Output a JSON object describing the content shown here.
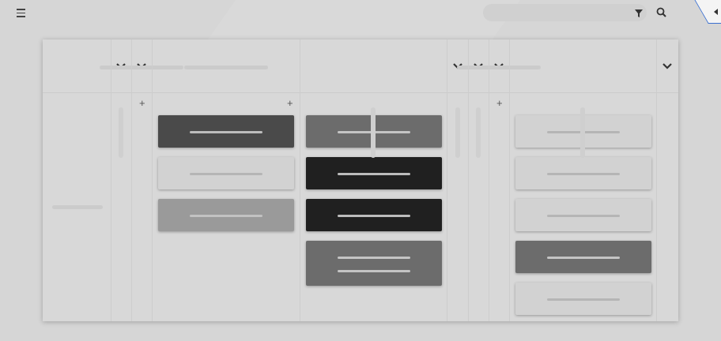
{
  "toolbar": {
    "menu_icon": "hamburger-menu-icon",
    "search": {
      "value": "",
      "placeholder": ""
    },
    "filter_icon": "filter-icon",
    "search_icon": "search-icon",
    "corner_icon": "collapse-arrow-icon"
  },
  "board": {
    "columns": [
      {
        "name": "",
        "collapsed": true
      },
      {
        "name": "",
        "collapsed": true
      },
      {
        "name": "",
        "collapsed": false,
        "add_label": "+",
        "cards": [
          {
            "lines": 1,
            "color": "#4a4a4a",
            "line_color": "#bdbdbd"
          },
          {
            "lines": 1,
            "color": "#d2d2d2",
            "line_color": "#b5b5b5"
          },
          {
            "lines": 1,
            "color": "#9a9a9a",
            "line_color": "#c2c2c2"
          }
        ]
      },
      {
        "name": "",
        "collapsed": false,
        "add_label": "+",
        "cards": [
          {
            "lines": 1,
            "color": "#6c6c6c",
            "line_color": "#c4c4c4"
          },
          {
            "lines": 1,
            "color": "#202020",
            "line_color": "#bcbcbc"
          },
          {
            "lines": 1,
            "color": "#202020",
            "line_color": "#bcbcbc"
          },
          {
            "lines": 2,
            "color": "#6c6c6c",
            "line_color": "#c4c4c4"
          }
        ]
      },
      {
        "name": "",
        "collapsed": true
      },
      {
        "name": "",
        "collapsed": true
      },
      {
        "name": "",
        "collapsed": true
      },
      {
        "name": "",
        "collapsed": false,
        "add_label": "+",
        "cards": [
          {
            "lines": 1,
            "color": "#d2d2d2",
            "line_color": "#b5b5b5"
          },
          {
            "lines": 1,
            "color": "#d2d2d2",
            "line_color": "#b5b5b5"
          },
          {
            "lines": 1,
            "color": "#d2d2d2",
            "line_color": "#b5b5b5"
          },
          {
            "lines": 1,
            "color": "#6c6c6c",
            "line_color": "#c4c4c4"
          },
          {
            "lines": 1,
            "color": "#d2d2d2",
            "line_color": "#b5b5b5"
          }
        ]
      },
      {
        "name": "",
        "collapsed": true
      }
    ]
  }
}
